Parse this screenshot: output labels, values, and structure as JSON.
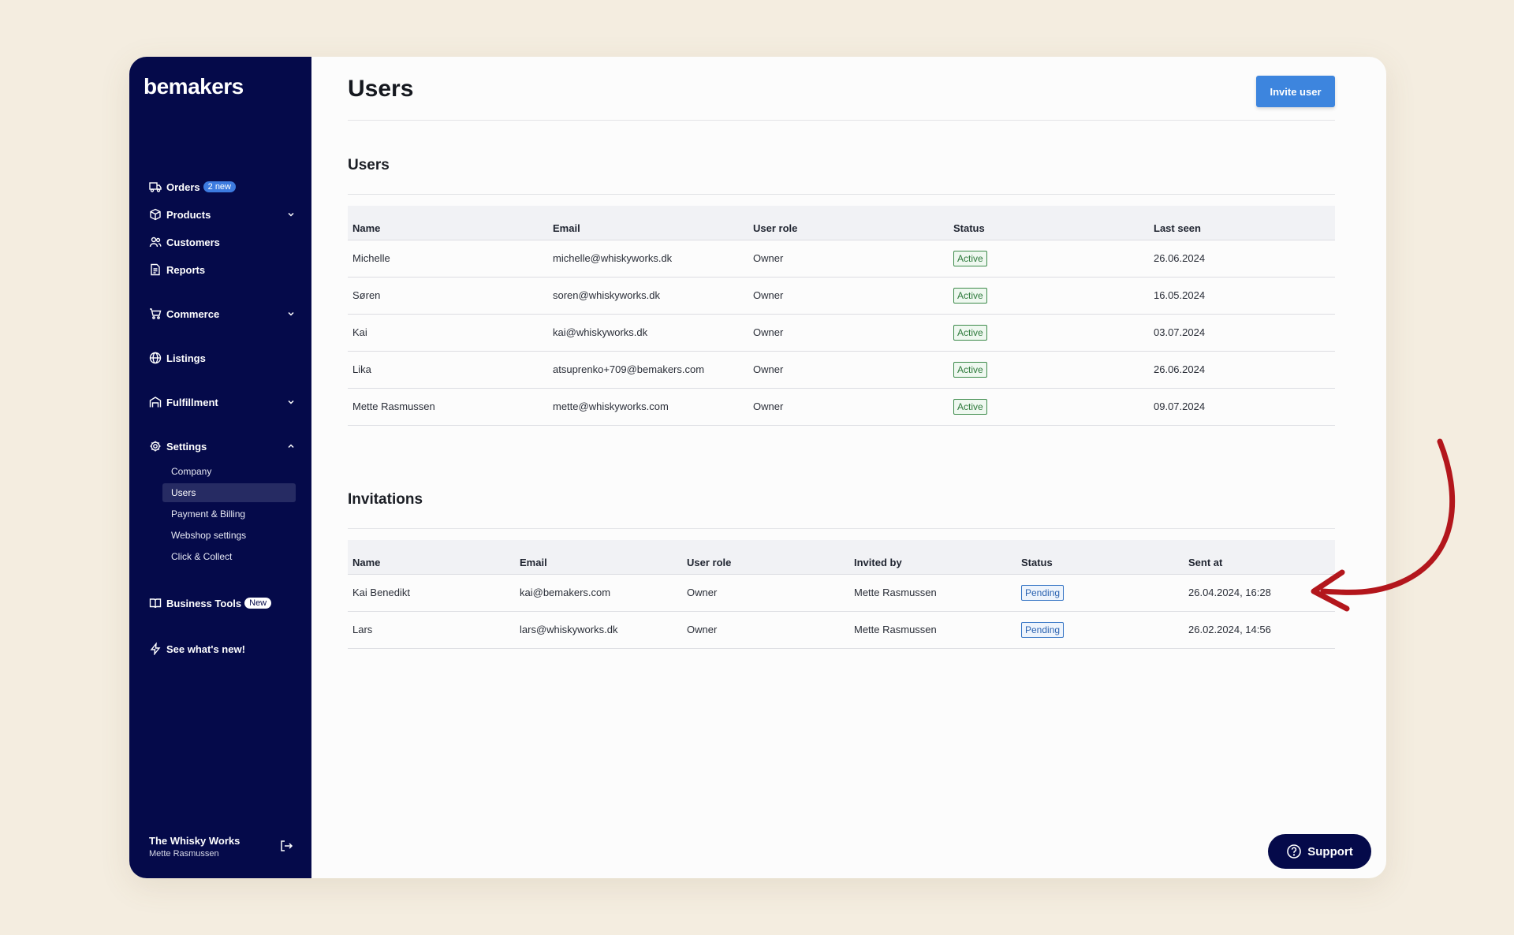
{
  "brand": {
    "logo": "bemakers"
  },
  "sidebar": {
    "orders": {
      "label": "Orders",
      "badge": "2 new",
      "icon": "truck-icon"
    },
    "products": {
      "label": "Products",
      "icon": "box-icon"
    },
    "customers": {
      "label": "Customers",
      "icon": "users-icon"
    },
    "reports": {
      "label": "Reports",
      "icon": "document-icon"
    },
    "commerce": {
      "label": "Commerce",
      "icon": "cart-icon"
    },
    "listings": {
      "label": "Listings",
      "icon": "globe-icon"
    },
    "fulfillment": {
      "label": "Fulfillment",
      "icon": "warehouse-icon"
    },
    "settings": {
      "label": "Settings",
      "icon": "gear-icon",
      "children": [
        "Company",
        "Users",
        "Payment & Billing",
        "Webshop settings",
        "Click & Collect"
      ],
      "active": "Users"
    },
    "business_tools": {
      "label": "Business Tools",
      "badge": "New",
      "icon": "book-icon"
    },
    "whats_new": {
      "label": "See what's new!",
      "icon": "bolt-icon"
    },
    "footer": {
      "company": "The Whisky Works",
      "user": "Mette Rasmussen"
    }
  },
  "page": {
    "title": "Users",
    "invite_button": "Invite user"
  },
  "users_section": {
    "title": "Users",
    "columns": [
      "Name",
      "Email",
      "User role",
      "Status",
      "Last seen"
    ],
    "rows": [
      [
        "Michelle",
        "michelle@whiskyworks.dk",
        "Owner",
        "Active",
        "26.06.2024"
      ],
      [
        "Søren",
        "soren@whiskyworks.dk",
        "Owner",
        "Active",
        "16.05.2024"
      ],
      [
        "Kai",
        "kai@whiskyworks.dk",
        "Owner",
        "Active",
        "03.07.2024"
      ],
      [
        "Lika",
        "atsuprenko+709@bemakers.com",
        "Owner",
        "Active",
        "26.06.2024"
      ],
      [
        "Mette Rasmussen",
        "mette@whiskyworks.com",
        "Owner",
        "Active",
        "09.07.2024"
      ]
    ]
  },
  "invitations_section": {
    "title": "Invitations",
    "columns": [
      "Name",
      "Email",
      "User role",
      "Invited by",
      "Status",
      "Sent at"
    ],
    "rows": [
      [
        "Kai Benedikt",
        "kai@bemakers.com",
        "Owner",
        "Mette Rasmussen",
        "Pending",
        "26.04.2024, 16:28"
      ],
      [
        "Lars",
        "lars@whiskyworks.dk",
        "Owner",
        "Mette Rasmussen",
        "Pending",
        "26.02.2024, 14:56"
      ]
    ]
  },
  "support": {
    "label": "Support",
    "icon": "help-circle-icon"
  },
  "colors": {
    "sidebar": "#050a4a",
    "accent": "#3d85de",
    "annotation_arrow": "#b3161c",
    "active": "#2e7a3c",
    "pending": "#2a62b0"
  }
}
